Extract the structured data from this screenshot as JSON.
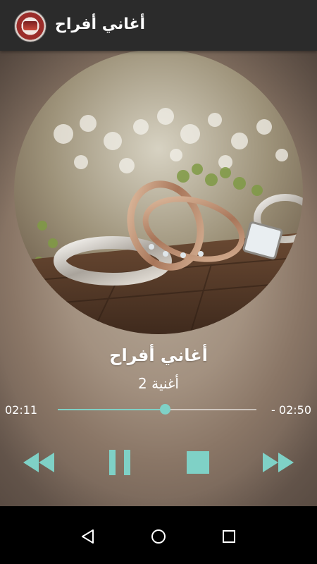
{
  "app": {
    "title": "أغاني أفراح",
    "logo_icon": "app-logo-icon"
  },
  "player": {
    "song_title": "أغاني أفراح",
    "song_subtitle": "أغنية 2",
    "elapsed": "02:11",
    "remaining": "- 02:50",
    "progress_fraction": 0.54,
    "accent_color": "#7fd1c6"
  },
  "controls": {
    "rewind_icon": "fast-rewind-icon",
    "pause_icon": "pause-icon",
    "stop_icon": "stop-icon",
    "forward_icon": "fast-forward-icon"
  },
  "navigation": {
    "back_icon": "back-icon",
    "home_icon": "home-icon",
    "recents_icon": "recents-icon"
  }
}
